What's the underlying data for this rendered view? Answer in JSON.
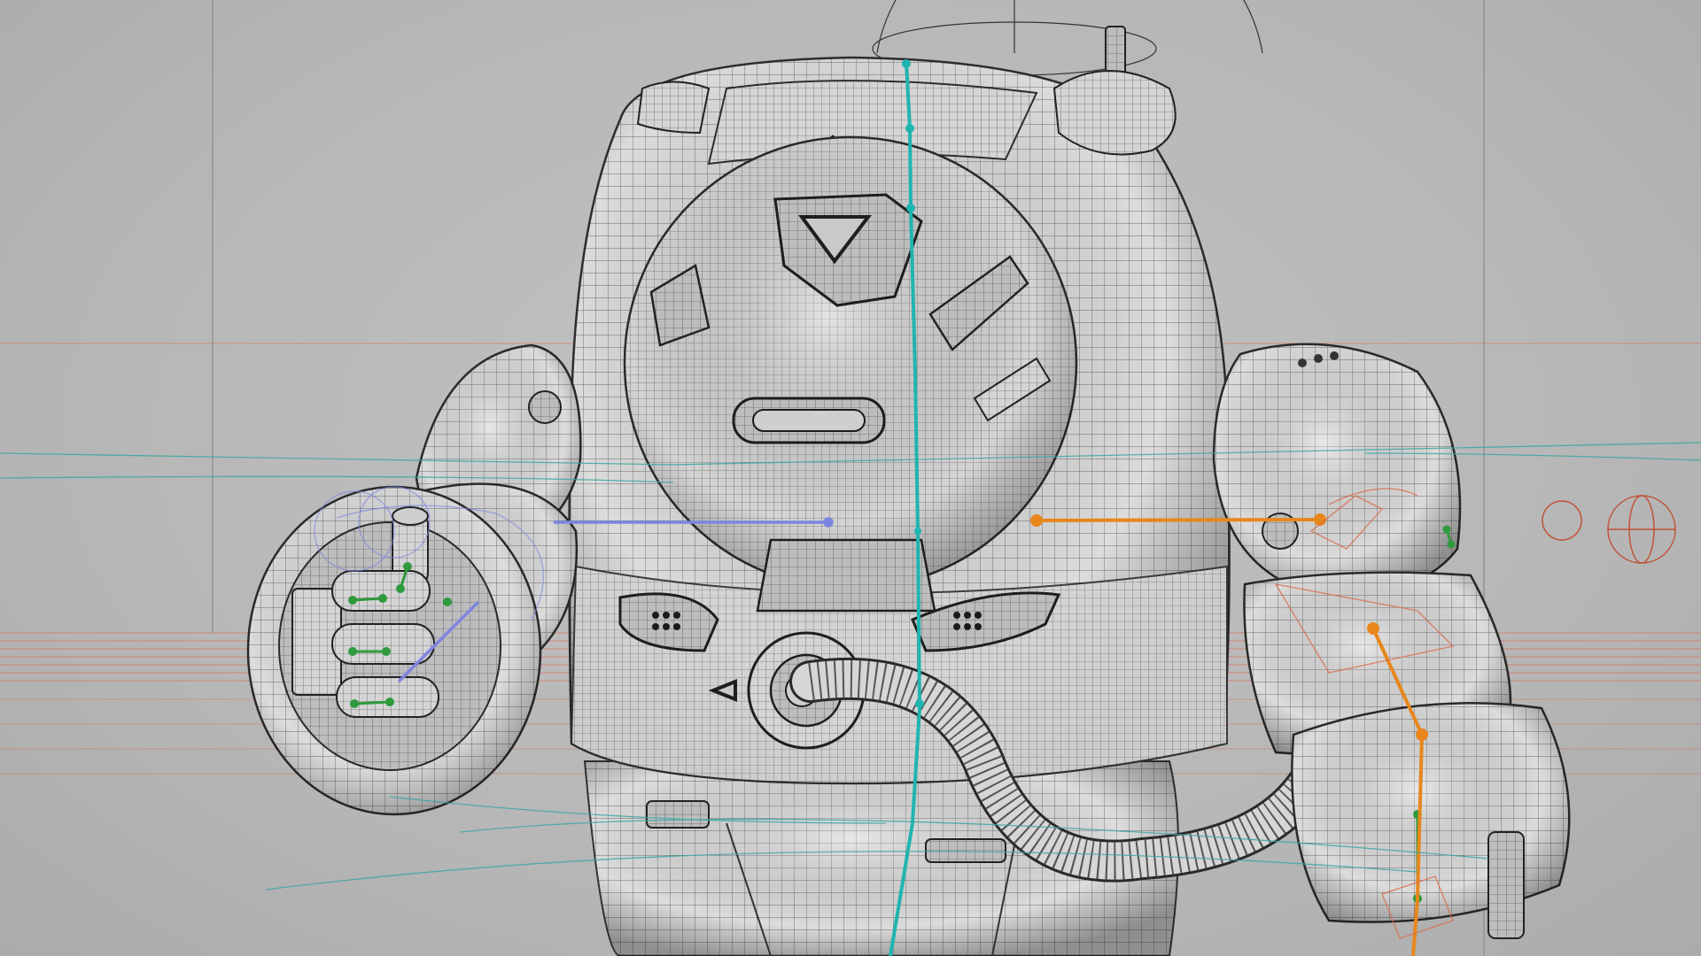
{
  "viewport": {
    "shading_mode": "wireframe-on-shaded",
    "background_color": "#b9b9b9"
  },
  "colors": {
    "mesh_fill": "#d9d9d9",
    "mesh_shadow": "#8f8f8f",
    "wire": "#3a3a3a",
    "spine_bone": "#1fb5b0",
    "left_arm_bone": "#7b86e0",
    "right_arm_bone": "#e8861c",
    "joint_marker": "#2e9a3c",
    "grid_orange": "#d96a4a",
    "grid_teal": "#3fa6a3",
    "control_circle": "#c0553a"
  },
  "rig": {
    "character": "armored-mech-suit",
    "bones": [
      "spine",
      "left-arm",
      "right-arm",
      "right-forearm",
      "finger-joints"
    ],
    "controls": [
      "head-circle-control",
      "shoulder-circle-control",
      "shoulder-cross-control"
    ]
  },
  "icons": {
    "head_arrow": "triangle-up-icon",
    "chest_arrow": "triangle-down-icon",
    "hip_arrow": "triangle-left-icon"
  }
}
